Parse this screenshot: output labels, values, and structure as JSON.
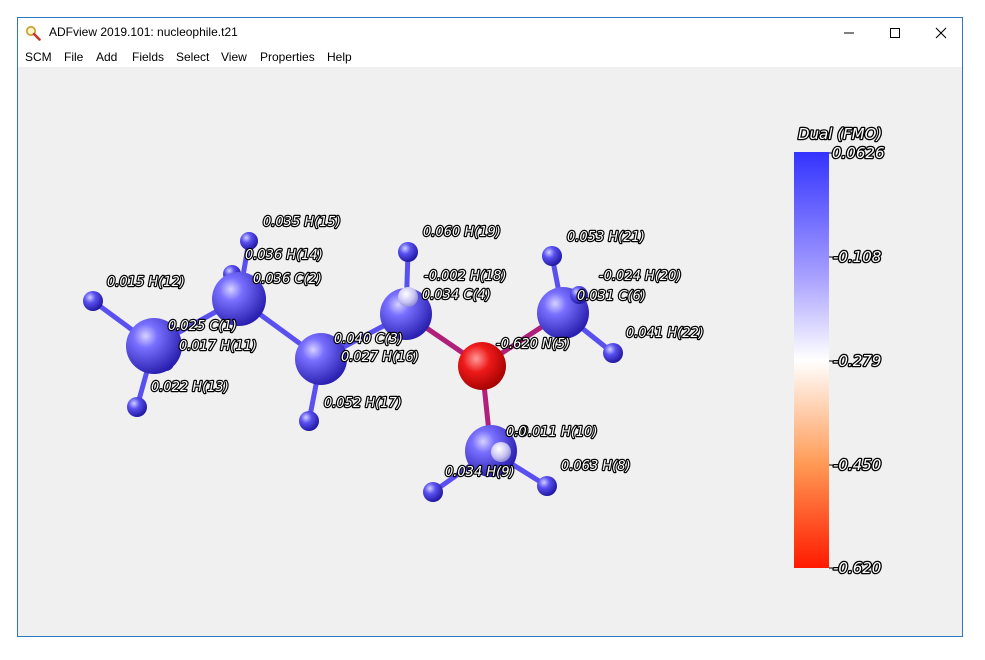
{
  "window": {
    "title": "ADFview 2019.101: nucleophile.t21",
    "icons": {
      "app": "magnifier-icon",
      "minimize": "minimize-icon",
      "maximize": "maximize-icon",
      "close": "close-icon"
    }
  },
  "menu": {
    "items": [
      "SCM",
      "File",
      "Add",
      "Fields",
      "Select",
      "View",
      "Properties",
      "Help"
    ]
  },
  "molecule": {
    "atom_labels": [
      "0.035 H(15)",
      "0.036 H(14)",
      "0.036 C(2)",
      "0.015 H(12)",
      "0.025 C(1)",
      "0.017 H(11)",
      "0.022 H(13)",
      "0.040 C(3)",
      "0.027 H(16)",
      "0.052 H(17)",
      "0.060 H(19)",
      "-0.002 H(18)",
      "0.034 C(4)",
      "0.053 H(21)",
      "-0.024 H(20)",
      "0.031 C(6)",
      "0.041 H(22)",
      "-0.620 N(5)",
      "-0.011 H(10)",
      "0.0",
      "0.063 H(8)",
      "0.034 H(9)"
    ]
  },
  "legend": {
    "title": "Dual (FMO)",
    "ticks": [
      "0.0626",
      "-0.108",
      "-0.279",
      "-0.450",
      "-0.620"
    ],
    "colors": {
      "top": "#3333ff",
      "mid": "#ffffff",
      "lower": "#ff9a55",
      "bottom": "#ff1a00"
    }
  },
  "colors": {
    "atom_blue": "#5a50f0",
    "atom_nitrogen": "#ee1a1a",
    "bond_magenta": "#b0207a",
    "window_border": "#2b79c2"
  }
}
